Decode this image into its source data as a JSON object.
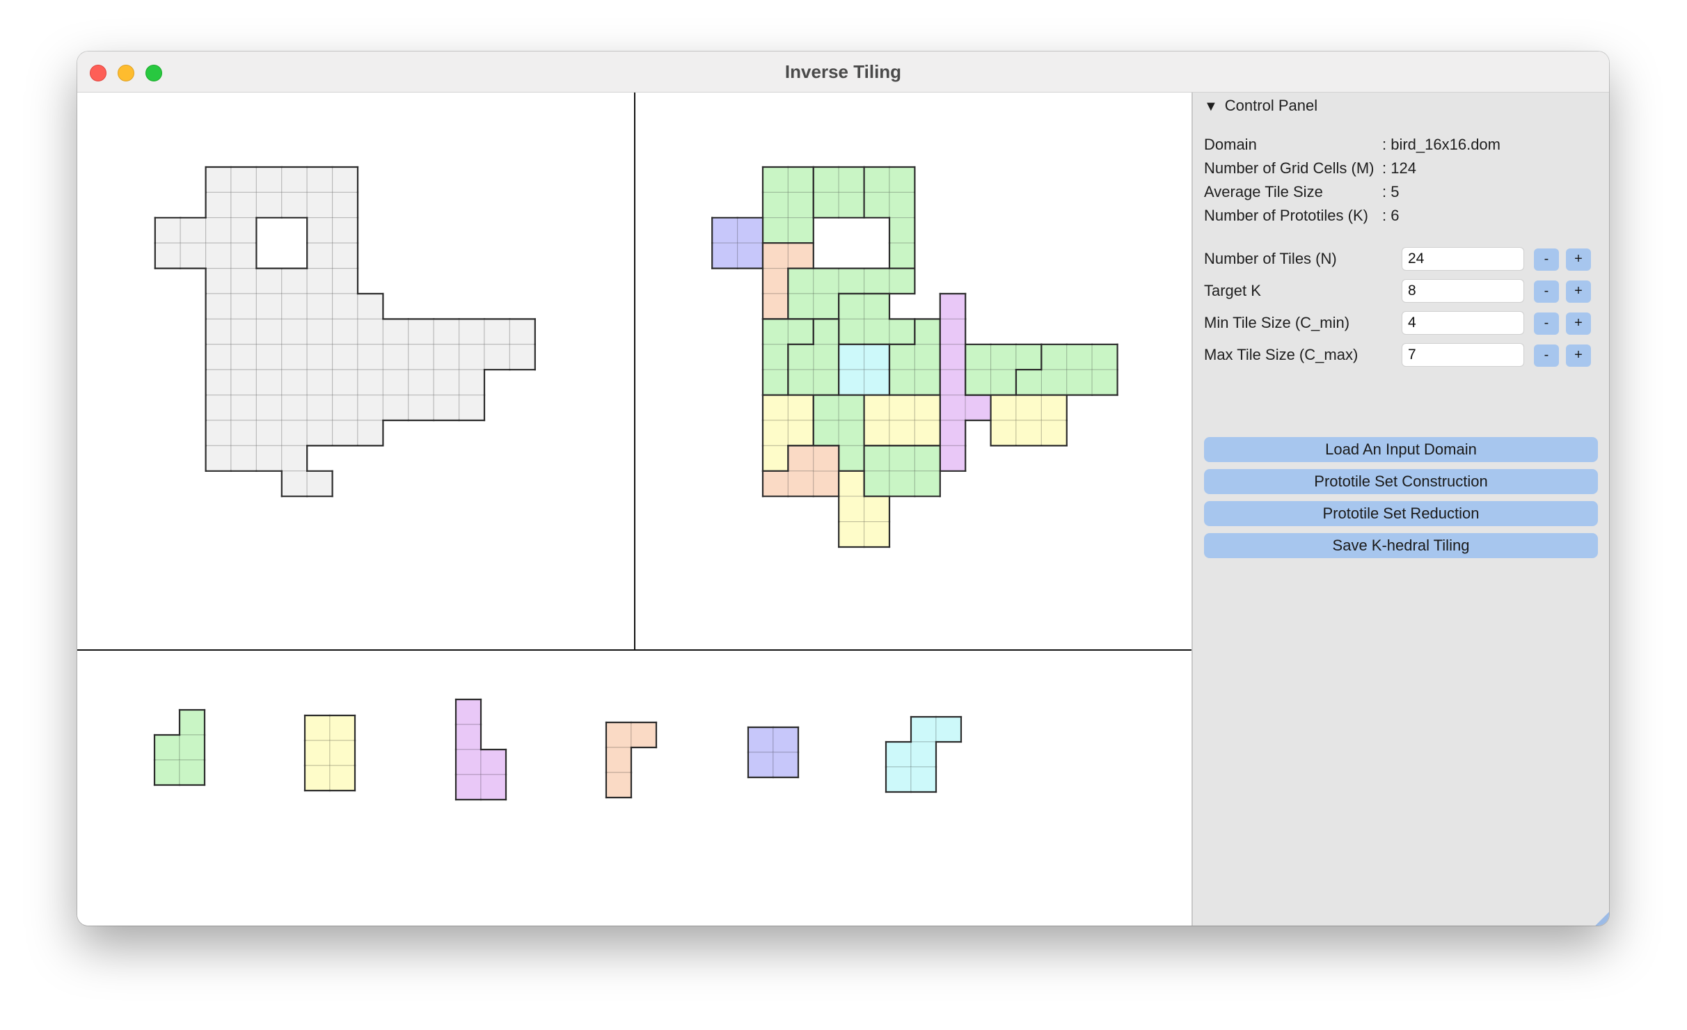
{
  "window": {
    "title": "Inverse Tiling"
  },
  "panel": {
    "header": "Control Panel",
    "info": [
      {
        "label": "Domain",
        "value": ": bird_16x16.dom"
      },
      {
        "label": "Number of Grid Cells (M)",
        "value": ": 124"
      },
      {
        "label": "Average Tile Size",
        "value": ": 5"
      },
      {
        "label": "Number of Prototiles (K)",
        "value": ": 6"
      }
    ],
    "params": [
      {
        "label": "Number of Tiles (N)",
        "value": "24"
      },
      {
        "label": "Target K",
        "value": "8"
      },
      {
        "label": "Min Tile Size (C_min)",
        "value": "4"
      },
      {
        "label": "Max Tile Size (C_max)",
        "value": "7"
      }
    ],
    "stepper_minus": "-",
    "stepper_plus": "+",
    "buttons": [
      "Load An Input Domain",
      "Prototile Set Construction",
      "Prototile Set Reduction",
      "Save K-hedral Tiling"
    ]
  },
  "colors": {
    "green": "#c9f5c5",
    "yellow": "#fefcc9",
    "purple": "#e9c8f7",
    "orange": "#fadac5",
    "blue": "#c7c7fa",
    "cyan": "#cdf9fa",
    "domain": "#f1f1f1",
    "outline": "#2b2b2b"
  },
  "domain": {
    "rows": [
      [
        4,
        5,
        6,
        7,
        8,
        9
      ],
      [
        4,
        5,
        6,
        7,
        8,
        9
      ],
      [
        2,
        3,
        4,
        5,
        8,
        9
      ],
      [
        2,
        3,
        4,
        5,
        8,
        9
      ],
      [
        4,
        5,
        6,
        7,
        8,
        9
      ],
      [
        4,
        5,
        6,
        7,
        8,
        9,
        10
      ],
      [
        4,
        5,
        6,
        7,
        8,
        9,
        10,
        11,
        12,
        13,
        14,
        15,
        16
      ],
      [
        4,
        5,
        6,
        7,
        8,
        9,
        10,
        11,
        12,
        13,
        14,
        15,
        16
      ],
      [
        4,
        5,
        6,
        7,
        8,
        9,
        10,
        11,
        12,
        13,
        14
      ],
      [
        4,
        5,
        6,
        7,
        8,
        9,
        10,
        11,
        12,
        13,
        14
      ],
      [
        4,
        5,
        6,
        7,
        8,
        9,
        10
      ],
      [
        4,
        5,
        6,
        7
      ],
      [
        7,
        8
      ]
    ]
  },
  "tiling": [
    {
      "color": "green",
      "cells": [
        [
          0,
          0
        ],
        [
          0,
          1
        ],
        [
          1,
          0
        ],
        [
          1,
          1
        ],
        [
          2,
          0
        ],
        [
          2,
          1
        ]
      ]
    },
    {
      "color": "green",
      "cells": [
        [
          0,
          2
        ],
        [
          0,
          3
        ],
        [
          1,
          2
        ],
        [
          1,
          3
        ]
      ]
    },
    {
      "color": "green",
      "cells": [
        [
          0,
          4
        ],
        [
          0,
          5
        ],
        [
          1,
          4
        ],
        [
          1,
          5
        ],
        [
          2,
          5
        ],
        [
          3,
          5
        ]
      ]
    },
    {
      "color": "blue",
      "cells": [
        [
          2,
          -2
        ],
        [
          2,
          -1
        ],
        [
          3,
          -2
        ],
        [
          3,
          -1
        ]
      ]
    },
    {
      "color": "orange",
      "cells": [
        [
          3,
          0
        ],
        [
          3,
          1
        ],
        [
          4,
          0
        ],
        [
          5,
          0
        ]
      ]
    },
    {
      "color": "green",
      "cells": [
        [
          4,
          1
        ],
        [
          4,
          2
        ],
        [
          4,
          3
        ],
        [
          5,
          1
        ],
        [
          5,
          2
        ],
        [
          4,
          4
        ],
        [
          4,
          5
        ]
      ]
    },
    {
      "color": "green",
      "cells": [
        [
          5,
          3
        ],
        [
          5,
          4
        ],
        [
          6,
          3
        ],
        [
          6,
          4
        ],
        [
          6,
          5
        ]
      ]
    },
    {
      "color": "green",
      "cells": [
        [
          6,
          0
        ],
        [
          6,
          1
        ],
        [
          7,
          0
        ],
        [
          8,
          0
        ]
      ]
    },
    {
      "color": "green",
      "cells": [
        [
          6,
          2
        ],
        [
          7,
          2
        ],
        [
          7,
          1
        ],
        [
          8,
          1
        ],
        [
          8,
          2
        ]
      ]
    },
    {
      "color": "cyan",
      "cells": [
        [
          7,
          3
        ],
        [
          7,
          4
        ],
        [
          8,
          3
        ],
        [
          8,
          4
        ]
      ]
    },
    {
      "color": "green",
      "cells": [
        [
          7,
          5
        ],
        [
          8,
          5
        ],
        [
          6,
          6
        ],
        [
          7,
          6
        ],
        [
          8,
          6
        ]
      ]
    },
    {
      "color": "purple",
      "cells": [
        [
          5,
          7
        ],
        [
          6,
          7
        ],
        [
          7,
          7
        ],
        [
          8,
          7
        ],
        [
          9,
          7
        ],
        [
          9,
          8
        ],
        [
          10,
          7
        ],
        [
          11,
          7
        ]
      ]
    },
    {
      "color": "green",
      "cells": [
        [
          7,
          8
        ],
        [
          7,
          9
        ],
        [
          7,
          10
        ],
        [
          8,
          8
        ],
        [
          8,
          9
        ]
      ]
    },
    {
      "color": "green",
      "cells": [
        [
          7,
          11
        ],
        [
          7,
          12
        ],
        [
          7,
          13
        ],
        [
          8,
          11
        ],
        [
          8,
          10
        ],
        [
          8,
          12
        ],
        [
          8,
          13
        ]
      ]
    },
    {
      "color": "yellow",
      "cells": [
        [
          9,
          0
        ],
        [
          9,
          1
        ],
        [
          10,
          0
        ],
        [
          10,
          1
        ],
        [
          11,
          0
        ]
      ]
    },
    {
      "color": "green",
      "cells": [
        [
          9,
          2
        ],
        [
          9,
          3
        ],
        [
          10,
          2
        ],
        [
          10,
          3
        ],
        [
          11,
          3
        ]
      ]
    },
    {
      "color": "yellow",
      "cells": [
        [
          9,
          4
        ],
        [
          9,
          5
        ],
        [
          9,
          6
        ],
        [
          10,
          4
        ],
        [
          10,
          5
        ],
        [
          10,
          6
        ]
      ]
    },
    {
      "color": "yellow",
      "cells": [
        [
          9,
          9
        ],
        [
          9,
          10
        ],
        [
          9,
          11
        ],
        [
          10,
          9
        ],
        [
          10,
          10
        ],
        [
          10,
          11
        ]
      ]
    },
    {
      "color": "orange",
      "cells": [
        [
          11,
          1
        ],
        [
          12,
          0
        ],
        [
          12,
          1
        ],
        [
          12,
          2
        ],
        [
          11,
          2
        ]
      ]
    },
    {
      "color": "green",
      "cells": [
        [
          11,
          4
        ],
        [
          11,
          5
        ],
        [
          11,
          6
        ],
        [
          12,
          4
        ],
        [
          12,
          5
        ],
        [
          12,
          6
        ]
      ]
    },
    {
      "color": "yellow",
      "cells": [
        [
          12,
          3
        ],
        [
          13,
          3
        ],
        [
          13,
          4
        ],
        [
          14,
          3
        ],
        [
          14,
          4
        ]
      ]
    }
  ],
  "prototiles": [
    {
      "color": "green",
      "cells": [
        [
          0,
          1
        ],
        [
          1,
          0
        ],
        [
          1,
          1
        ],
        [
          2,
          0
        ],
        [
          2,
          1
        ]
      ]
    },
    {
      "color": "yellow",
      "cells": [
        [
          0,
          0
        ],
        [
          0,
          1
        ],
        [
          1,
          0
        ],
        [
          1,
          1
        ],
        [
          2,
          0
        ],
        [
          2,
          1
        ]
      ]
    },
    {
      "color": "purple",
      "cells": [
        [
          0,
          0
        ],
        [
          1,
          0
        ],
        [
          2,
          0
        ],
        [
          2,
          1
        ],
        [
          3,
          0
        ],
        [
          3,
          1
        ]
      ]
    },
    {
      "color": "orange",
      "cells": [
        [
          0,
          0
        ],
        [
          0,
          1
        ],
        [
          1,
          0
        ],
        [
          2,
          0
        ]
      ]
    },
    {
      "color": "blue",
      "cells": [
        [
          0,
          0
        ],
        [
          0,
          1
        ],
        [
          1,
          0
        ],
        [
          1,
          1
        ]
      ]
    },
    {
      "color": "cyan",
      "cells": [
        [
          0,
          1
        ],
        [
          0,
          2
        ],
        [
          1,
          0
        ],
        [
          1,
          1
        ],
        [
          2,
          0
        ],
        [
          2,
          1
        ]
      ]
    }
  ]
}
